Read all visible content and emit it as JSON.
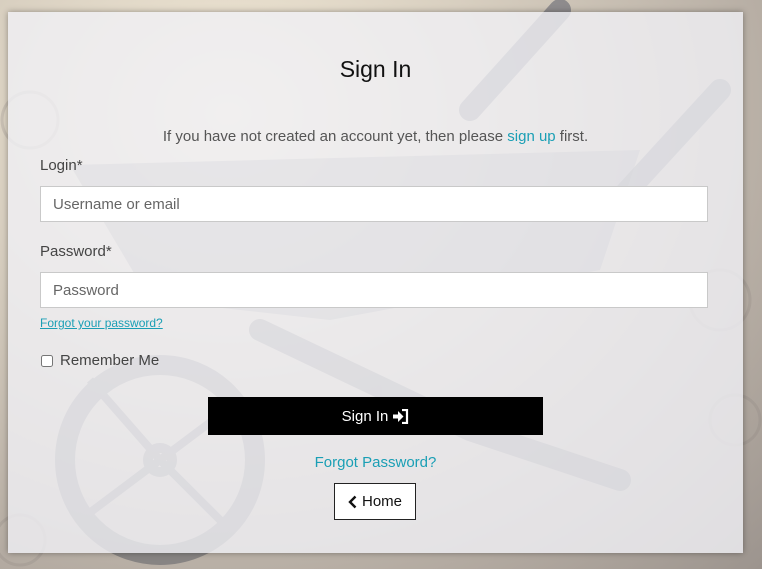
{
  "page": {
    "title": "Sign In",
    "intro_prefix": "If you have not created an account yet, then please ",
    "intro_link": "sign up",
    "intro_suffix": " first."
  },
  "form": {
    "login_label": "Login*",
    "login_placeholder": "Username or email",
    "login_value": "",
    "password_label": "Password*",
    "password_placeholder": "Password",
    "password_value": "",
    "forgot_small": "Forgot your password?",
    "remember_label": "Remember Me",
    "remember_checked": false
  },
  "actions": {
    "signin_label": "Sign In",
    "signin_icon": "sign-in-icon",
    "forgot_link": "Forgot Password?",
    "home_label": "Home",
    "home_icon": "chevron-left-icon"
  },
  "colors": {
    "link": "#1a9fb5",
    "primary_button": "#000000"
  }
}
